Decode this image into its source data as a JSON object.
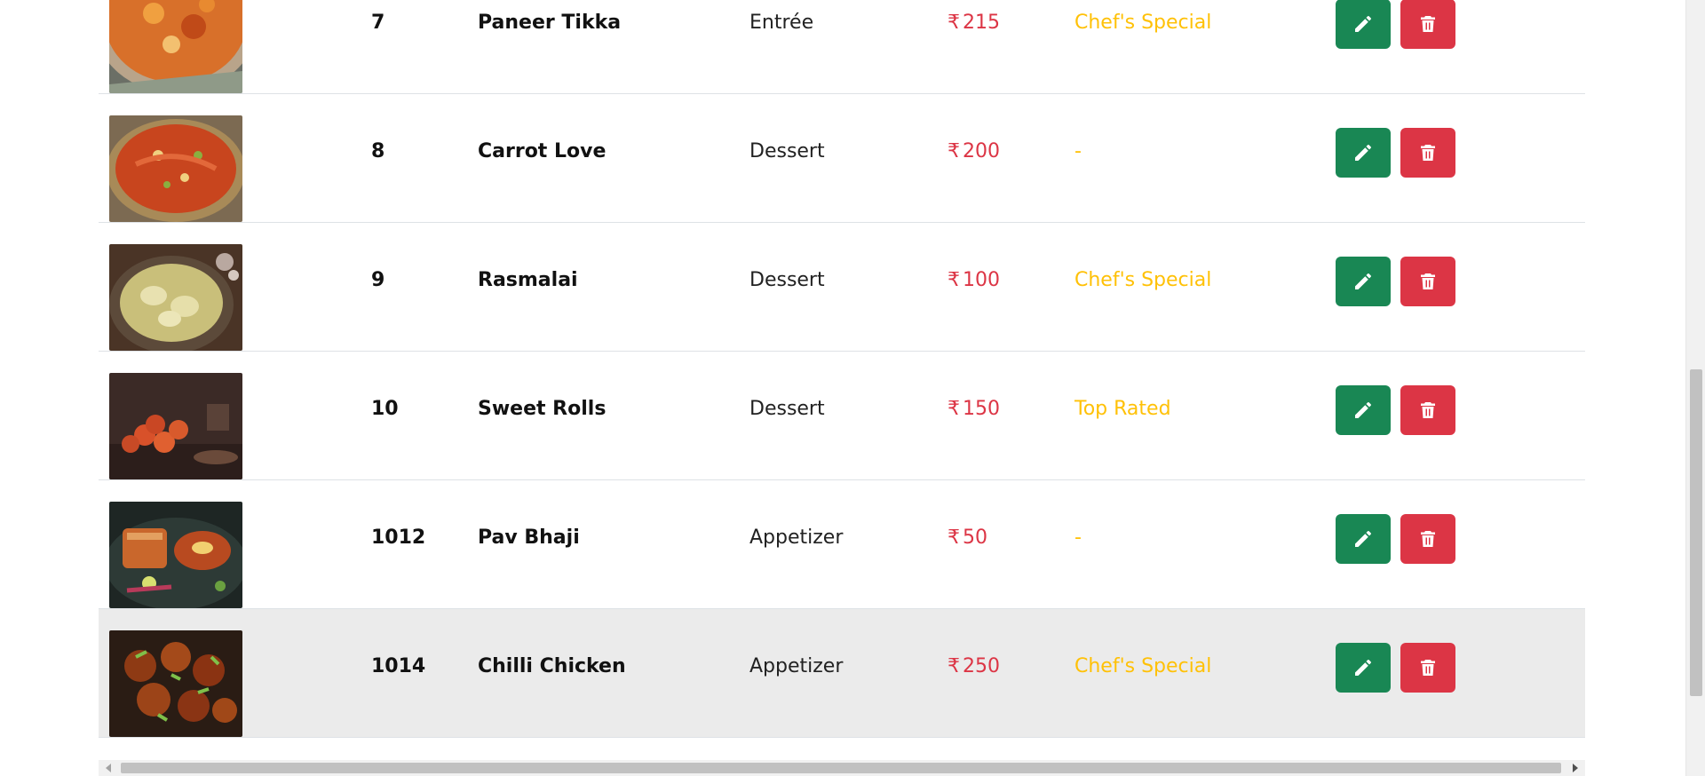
{
  "currency_symbol": "₹",
  "rows": [
    {
      "id": "7",
      "name": "Paneer Tikka",
      "category": "Entrée",
      "price": "215",
      "tag": "Chef's Special",
      "image": "paneer-tikka-dish-image"
    },
    {
      "id": "8",
      "name": "Carrot Love",
      "category": "Dessert",
      "price": "200",
      "tag": "-",
      "image": "carrot-halwa-dish-image"
    },
    {
      "id": "9",
      "name": "Rasmalai",
      "category": "Dessert",
      "price": "100",
      "tag": "Chef's Special",
      "image": "rasmalai-dish-image"
    },
    {
      "id": "10",
      "name": "Sweet Rolls",
      "category": "Dessert",
      "price": "150",
      "tag": "Top Rated",
      "image": "sweet-rolls-dish-image"
    },
    {
      "id": "1012",
      "name": "Pav Bhaji",
      "category": "Appetizer",
      "price": "50",
      "tag": "-",
      "image": "pav-bhaji-dish-image"
    },
    {
      "id": "1014",
      "name": "Chilli Chicken",
      "category": "Appetizer",
      "price": "250",
      "tag": "Chef's Special",
      "image": "chilli-chicken-dish-image"
    }
  ],
  "hovered_row_index": 5,
  "icons": {
    "edit": "pencil-icon",
    "delete": "trash-icon"
  },
  "colors": {
    "edit_button": "#198754",
    "delete_button": "#dc3545",
    "price_text": "#dc3545",
    "tag_text": "#ffc107",
    "hover_row": "#ebebeb"
  }
}
